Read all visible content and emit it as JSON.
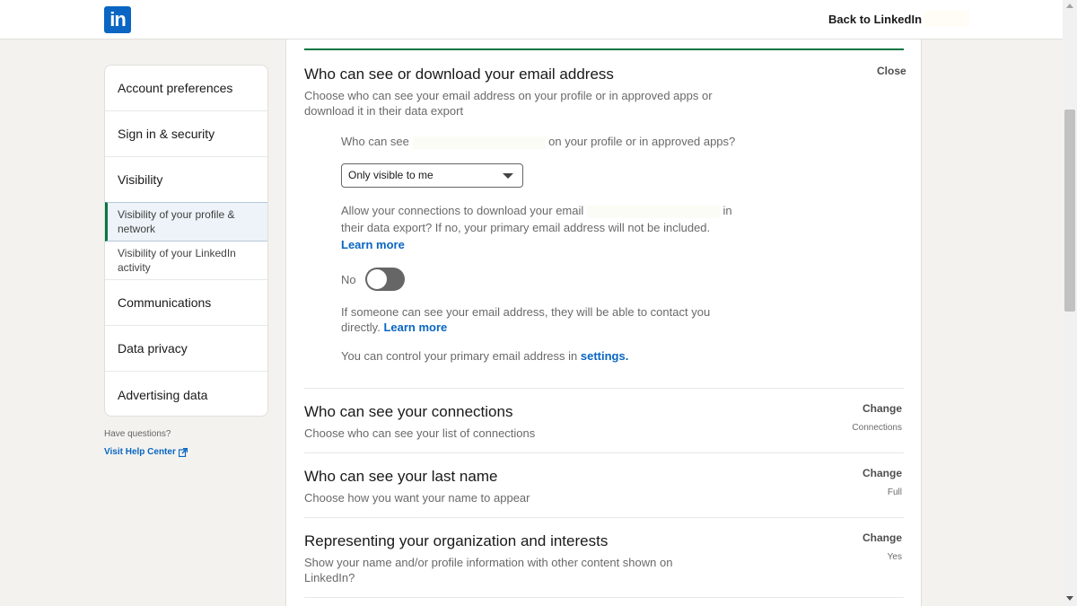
{
  "header": {
    "logo_text": "in",
    "back_link": "Back to LinkedIn"
  },
  "sidebar": {
    "items": [
      {
        "label": "Account preferences"
      },
      {
        "label": "Sign in & security"
      },
      {
        "label": "Visibility"
      }
    ],
    "sub_items": [
      {
        "label": "Visibility of your profile & network"
      },
      {
        "label": "Visibility of your LinkedIn activity"
      }
    ],
    "items_after": [
      {
        "label": "Communications"
      },
      {
        "label": "Data privacy"
      },
      {
        "label": "Advertising data"
      }
    ],
    "help_question": "Have questions?",
    "help_link": "Visit Help Center"
  },
  "email_section": {
    "title": "Who can see or download your email address",
    "description": "Choose who can see your email address on your profile or in approved apps or download it in their data export",
    "close_label": "Close",
    "q1_prefix": "Who can see",
    "q1_suffix": "on your profile or in approved apps?",
    "select_value": "Only visible to me",
    "q2_prefix": "Allow your connections to download your email",
    "q2_suffix": "in",
    "q2_line2": "their data export? If no, your primary email address will not be included.",
    "learn_more_1": "Learn more",
    "toggle_label": "No",
    "toggle_state": "off",
    "contact_text": "If someone can see your email address, they will be able to contact you directly.",
    "learn_more_2": "Learn more",
    "control_text": "You can control your primary email address in",
    "settings_link": "settings."
  },
  "settings_rows": [
    {
      "title": "Who can see your connections",
      "description": "Choose who can see your list of connections",
      "action": "Change",
      "value": "Connections"
    },
    {
      "title": "Who can see your last name",
      "description": "Choose how you want your name to appear",
      "action": "Change",
      "value": "Full"
    },
    {
      "title": "Representing your organization and interests",
      "description": "Show your name and/or profile information with other content shown on LinkedIn?",
      "action": "Change",
      "value": "Yes"
    }
  ],
  "colors": {
    "brand": "#0a66c2",
    "active_accent": "#057642"
  }
}
